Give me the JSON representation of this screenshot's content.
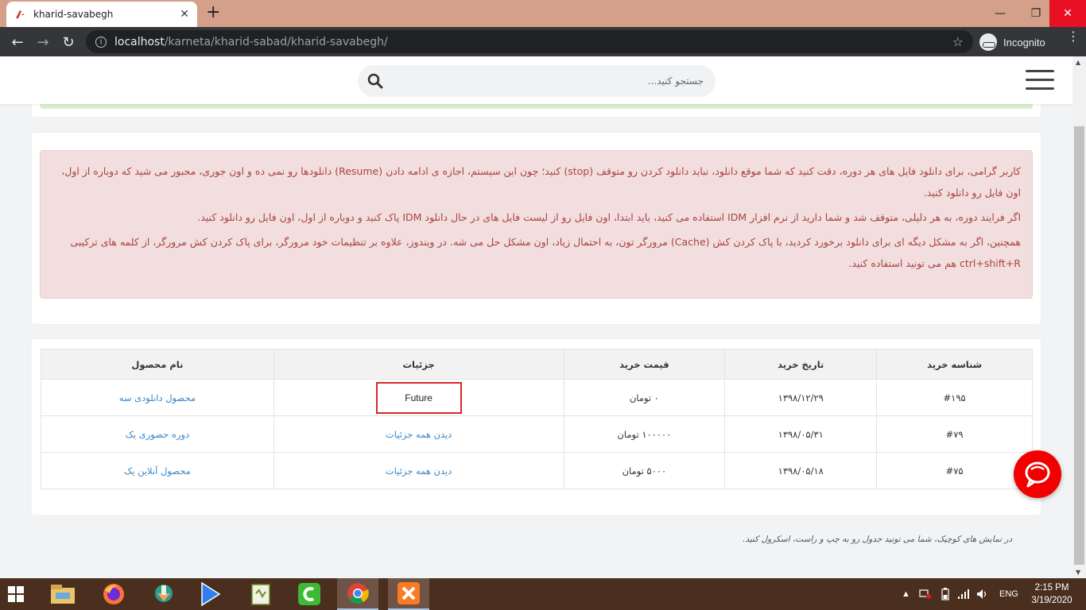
{
  "browser": {
    "tab_title": "kharid-savabegh",
    "url_host": "localhost",
    "url_path": "/karneta/kharid-sabad/kharid-savabegh/",
    "profile_label": "Incognito"
  },
  "header": {
    "search_placeholder": "جستجو کنید..."
  },
  "alert": {
    "paragraph_1": "کاربر گرامی، برای دانلود فایل های هر دوره، دقت کنید که شما موقع دانلود، نباید دانلود کردن رو متوقف (stop) کنید؛ چون این سیستم، اجازه ی ادامه دادن (Resume) دانلودها رو نمی ده و اون جوری، مجبور می شید که دوباره از اول، اون فایل رو دانلود کنید.",
    "paragraph_2": "اگر فرایند دوره، به هر دلیلی، متوقف شد و شما دارید از نرم افزار IDM استفاده می کنید، باید ابتدا، اون فایل رو از لیست فایل های در حال دانلود IDM پاک کنید و دوباره از اول، اون فایل رو دانلود کنید.",
    "paragraph_3": "همچنین، اگر به مشکل دیگه ای برای دانلود برخورد کردید، با پاک کردن کش (Cache) مرورگر تون، به احتمال زیاد، اون مشکل حل می شه. در ویندوز، علاوه بر تنظیمات خود مرورگر، برای پاک کردن کش مرورگر، از کلمه های ترکیبی ctrl+shift+R هم می تونید استفاده کنید."
  },
  "table": {
    "headers": {
      "id": "شناسه خرید",
      "date": "تاریخ خرید",
      "price": "قیمت خرید",
      "details": "جزئیات",
      "product": "نام محصول"
    },
    "rows": [
      {
        "id": "#۱۹۵",
        "date": "۱۳۹۸/۱۲/۲۹",
        "price": "۰ تومان",
        "details": "Future",
        "product": "محصول دانلودی سه"
      },
      {
        "id": "#۷۹",
        "date": "۱۳۹۸/۰۵/۳۱",
        "price": "۱۰۰۰۰۰ تومان",
        "details": "دیدن همه جزئیات",
        "product": "دوره حضوری یک"
      },
      {
        "id": "#۷۵",
        "date": "۱۳۹۸/۰۵/۱۸",
        "price": "۵۰۰۰ تومان",
        "details": "دیدن همه جزئیات",
        "product": "محصول آنلاین یک"
      }
    ]
  },
  "hint": "در نمایش های کوچیک، شما می تونید جدول رو به چپ و راست، اسکرول کنید.",
  "taskbar": {
    "language": "ENG",
    "time": "2:15 PM",
    "date": "3/19/2020"
  },
  "colors": {
    "tab_bar": "#d4a089",
    "alert_bg": "#f2dede",
    "alert_text": "#a94442",
    "link": "#3a86c8",
    "highlight_border": "#d9262b",
    "chat_button": "#f20000",
    "taskbar": "#4a2f1f"
  }
}
